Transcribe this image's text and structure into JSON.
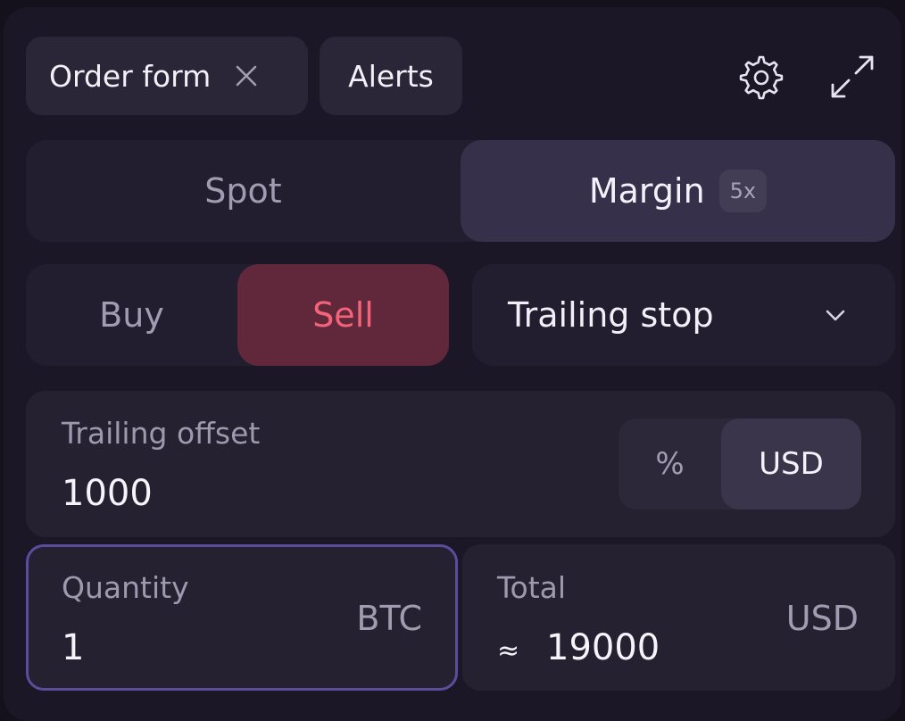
{
  "tabs": [
    {
      "label": "Order form"
    },
    {
      "label": "Alerts"
    }
  ],
  "icons": {
    "close": "close-icon",
    "settings": "gear-icon",
    "expand": "expand-icon",
    "dropdown": "chevron-down-icon"
  },
  "market_type": {
    "spot_label": "Spot",
    "margin_label": "Margin",
    "leverage_badge": "5x",
    "selected": "Margin"
  },
  "side": {
    "buy_label": "Buy",
    "sell_label": "Sell",
    "selected": "Sell"
  },
  "order_type": {
    "value": "Trailing stop"
  },
  "trailing_offset": {
    "label": "Trailing offset",
    "value": "1000",
    "unit_percent": "%",
    "unit_usd": "USD",
    "selected_unit": "USD"
  },
  "quantity": {
    "label": "Quantity",
    "value": "1",
    "unit": "BTC"
  },
  "total": {
    "label": "Total",
    "prefix": "≈",
    "value": "19000",
    "unit": "USD"
  },
  "colors": {
    "background": "#1c1727",
    "sell_accent": "#f26479",
    "sell_bg": "#61283c",
    "focus_border": "#5b4c9c"
  }
}
